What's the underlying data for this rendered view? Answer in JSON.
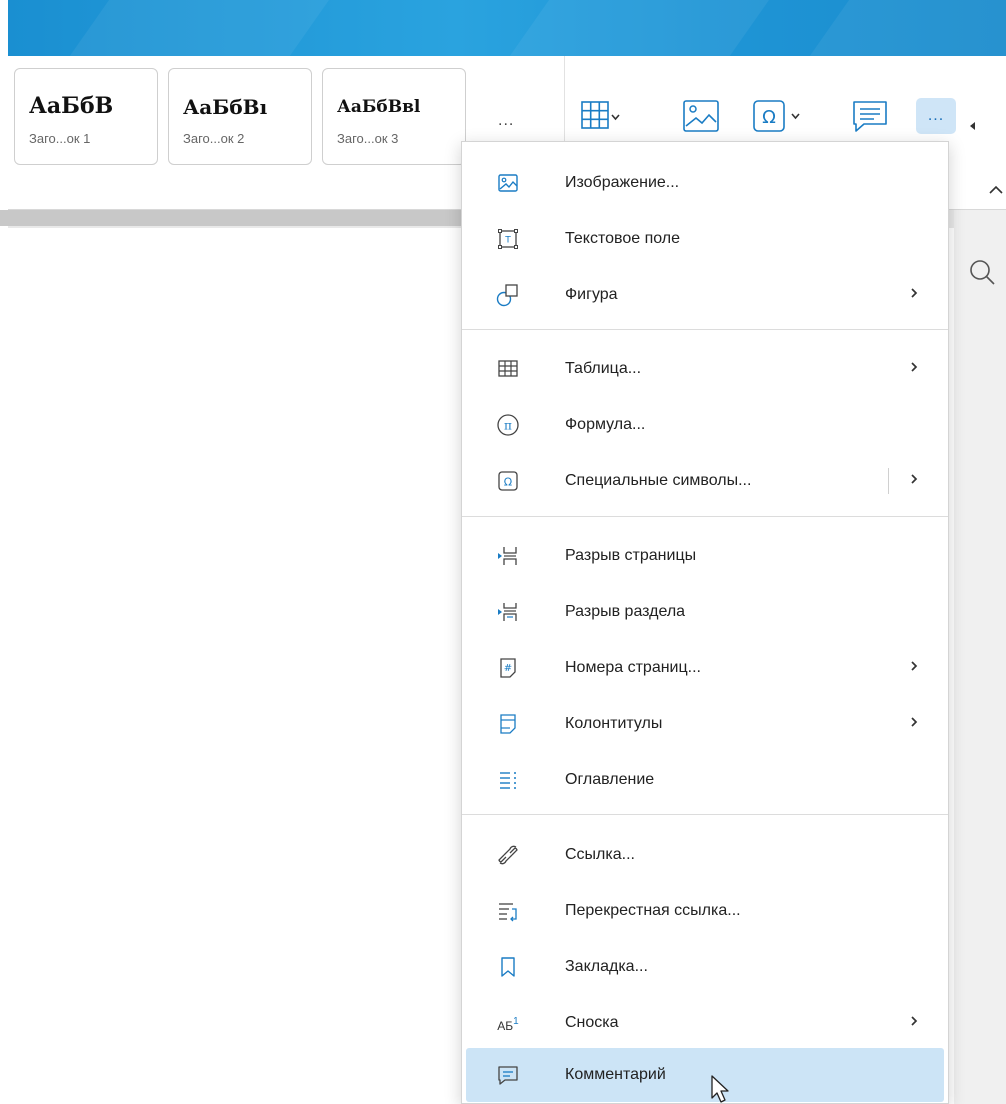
{
  "ribbon": {
    "styles": [
      {
        "sample": "АаБбВ",
        "caption": "Заго...ок 1"
      },
      {
        "sample": "АаБбВı",
        "caption": "Заго...ок 2"
      },
      {
        "sample": "АаБбВвl",
        "caption": "Заго...ок 3"
      }
    ],
    "styles_more": "...",
    "more_button": "..."
  },
  "menu": {
    "items": [
      {
        "label": "Изображение...",
        "icon": "image-icon"
      },
      {
        "label": "Текстовое поле",
        "icon": "text-box-icon"
      },
      {
        "label": "Фигура",
        "icon": "shape-icon",
        "submenu": true
      },
      {
        "label": "Таблица...",
        "icon": "table-icon",
        "submenu": true
      },
      {
        "label": "Формула...",
        "icon": "formula-icon"
      },
      {
        "label": "Специальные символы...",
        "icon": "omega-icon",
        "submenu": true,
        "split": true
      },
      {
        "label": "Разрыв страницы",
        "icon": "page-break-icon"
      },
      {
        "label": "Разрыв раздела",
        "icon": "section-break-icon"
      },
      {
        "label": "Номера страниц...",
        "icon": "page-numbers-icon",
        "submenu": true
      },
      {
        "label": "Колонтитулы",
        "icon": "header-footer-icon",
        "submenu": true
      },
      {
        "label": "Оглавление",
        "icon": "toc-icon"
      },
      {
        "label": "Ссылка...",
        "icon": "link-icon"
      },
      {
        "label": "Перекрестная ссылка...",
        "icon": "cross-reference-icon"
      },
      {
        "label": "Закладка...",
        "icon": "bookmark-icon"
      },
      {
        "label": "Сноска",
        "icon": "footnote-icon",
        "submenu": true
      },
      {
        "label": "Комментарий",
        "icon": "comment-icon",
        "highlighted": true
      }
    ],
    "footnote_icon_text": "АБ",
    "footnote_icon_sup": "1"
  },
  "colors": {
    "titlebar": "#1a8fd1",
    "accent": "#1a6fb8",
    "highlight": "#cce4f6"
  }
}
